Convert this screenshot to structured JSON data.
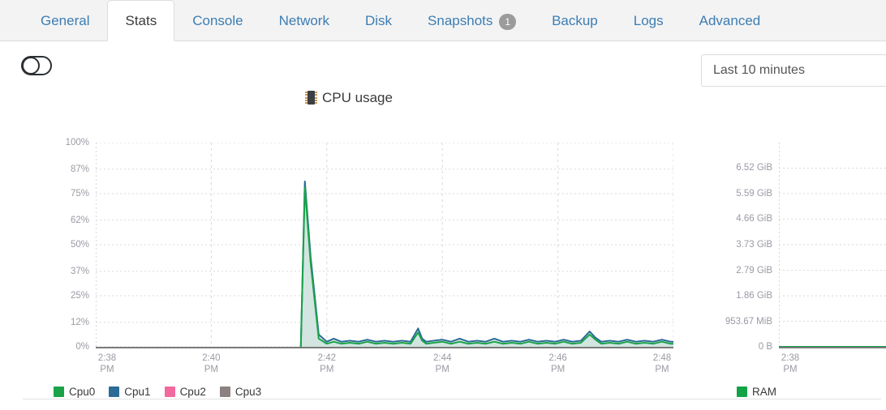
{
  "tabs": [
    {
      "label": "General",
      "active": false,
      "badge": null
    },
    {
      "label": "Stats",
      "active": true,
      "badge": null
    },
    {
      "label": "Console",
      "active": false,
      "badge": null
    },
    {
      "label": "Network",
      "active": false,
      "badge": null
    },
    {
      "label": "Disk",
      "active": false,
      "badge": null
    },
    {
      "label": "Snapshots",
      "active": false,
      "badge": "1"
    },
    {
      "label": "Backup",
      "active": false,
      "badge": null
    },
    {
      "label": "Logs",
      "active": false,
      "badge": null
    },
    {
      "label": "Advanced",
      "active": false,
      "badge": null
    }
  ],
  "controls": {
    "toggle_state": "off",
    "time_range_value": "Last 10 minutes"
  },
  "colors": {
    "tab_link": "#3c7db3",
    "tab_active_text": "#3a3a3a",
    "badge_bg": "#9b9b9b",
    "cpu0": "#1aa349",
    "cpu1": "#2b6b96",
    "cpu2": "#f2699e",
    "cpu3": "#8a8180",
    "ram": "#12a346",
    "grid": "#d8d8d8",
    "axis": "#7a7a7a",
    "area_fill": "#cfe3dd"
  },
  "chart_data": [
    {
      "type": "area",
      "id": "cpu-usage",
      "title": "CPU usage",
      "title_icon": "microchip-icon",
      "xlabel": "",
      "ylabel": "",
      "ylim": [
        0,
        100
      ],
      "ytick_labels": [
        "100%",
        "87%",
        "75%",
        "62%",
        "50%",
        "37%",
        "25%",
        "12%",
        "0%"
      ],
      "ytick_values": [
        100,
        87,
        75,
        62,
        50,
        37,
        25,
        12,
        0
      ],
      "xtick_labels": [
        "2:38\nPM",
        "2:40\nPM",
        "2:42\nPM",
        "2:44\nPM",
        "2:46\nPM",
        "2:48\nPM"
      ],
      "xtick_values": [
        0,
        2,
        4,
        6,
        8,
        10
      ],
      "xlim": [
        0,
        10
      ],
      "grid": true,
      "legend_position": "bottom-left",
      "legend": [
        "Cpu0",
        "Cpu1",
        "Cpu2",
        "Cpu3"
      ],
      "series": [
        {
          "name": "Cpu1",
          "color": "#2b6b96",
          "x": [
            3.55,
            3.62,
            3.72,
            3.86,
            4.0,
            4.12,
            4.25,
            4.4,
            4.55,
            4.7,
            4.85,
            5.0,
            5.15,
            5.3,
            5.45,
            5.58,
            5.65,
            5.72,
            5.85,
            6.0,
            6.15,
            6.3,
            6.45,
            6.6,
            6.75,
            6.9,
            7.05,
            7.2,
            7.35,
            7.5,
            7.65,
            7.8,
            7.95,
            8.1,
            8.25,
            8.4,
            8.55,
            8.65,
            8.75,
            8.9,
            9.05,
            9.2,
            9.35,
            9.5,
            9.65,
            9.8,
            9.95,
            10.0
          ],
          "y": [
            0,
            81,
            44,
            6,
            2.5,
            4,
            2.5,
            3,
            2.5,
            3.5,
            2.5,
            3,
            2.5,
            3,
            2.5,
            9,
            4,
            2.5,
            3,
            3.5,
            2.5,
            4,
            2.5,
            3,
            2.5,
            4,
            2.5,
            3,
            2.5,
            3.5,
            2.5,
            3,
            2.5,
            3.5,
            2.5,
            3,
            7.5,
            4.5,
            2.5,
            3,
            2.5,
            3.5,
            2.5,
            3,
            2.5,
            3.5,
            2.5,
            2.5
          ]
        },
        {
          "name": "Cpu0",
          "color": "#1aa349",
          "x": [
            3.55,
            3.62,
            3.72,
            3.86,
            4.0,
            4.12,
            4.25,
            4.4,
            4.55,
            4.7,
            4.85,
            5.0,
            5.15,
            5.3,
            5.45,
            5.58,
            5.65,
            5.72,
            5.85,
            6.0,
            6.15,
            6.3,
            6.45,
            6.6,
            6.75,
            6.9,
            7.05,
            7.2,
            7.35,
            7.5,
            7.65,
            7.8,
            7.95,
            8.1,
            8.25,
            8.4,
            8.55,
            8.65,
            8.75,
            8.9,
            9.05,
            9.2,
            9.35,
            9.5,
            9.65,
            9.8,
            9.95,
            10.0
          ],
          "y": [
            0,
            78,
            41,
            4,
            1.5,
            2.5,
            1.5,
            2,
            1.5,
            2.5,
            1.5,
            2,
            1.5,
            2,
            1.5,
            7,
            3,
            1.5,
            2,
            2.5,
            1.5,
            2.5,
            1.5,
            2,
            1.5,
            2.5,
            1.5,
            2,
            1.5,
            2.5,
            1.5,
            2,
            1.5,
            2.5,
            1.5,
            2,
            6,
            3.5,
            1.5,
            2,
            1.5,
            2.5,
            1.5,
            2,
            1.5,
            2.5,
            1.5,
            1.5
          ]
        },
        {
          "name": "Cpu2",
          "color": "#f2699e",
          "x": [],
          "y": []
        },
        {
          "name": "Cpu3",
          "color": "#8a8180",
          "x": [],
          "y": []
        }
      ]
    },
    {
      "type": "area",
      "id": "ram-usage",
      "title": "",
      "xlabel": "",
      "ylabel": "",
      "ylim": [
        0,
        7.45
      ],
      "ytick_labels": [
        "6.52 GiB",
        "5.59 GiB",
        "4.66 GiB",
        "3.73 GiB",
        "2.79 GiB",
        "1.86 GiB",
        "953.67 MiB",
        "0 B"
      ],
      "ytick_values": [
        6.52,
        5.59,
        4.66,
        3.73,
        2.79,
        1.86,
        0.93,
        0
      ],
      "xtick_labels": [
        "2:38\nPM"
      ],
      "xtick_values": [
        0
      ],
      "xlim": [
        0,
        10
      ],
      "grid": true,
      "legend_position": "bottom-left",
      "legend": [
        "RAM"
      ],
      "series": [
        {
          "name": "RAM",
          "color": "#12a346",
          "x": [
            0,
            10
          ],
          "y": [
            0,
            0
          ]
        }
      ]
    }
  ]
}
